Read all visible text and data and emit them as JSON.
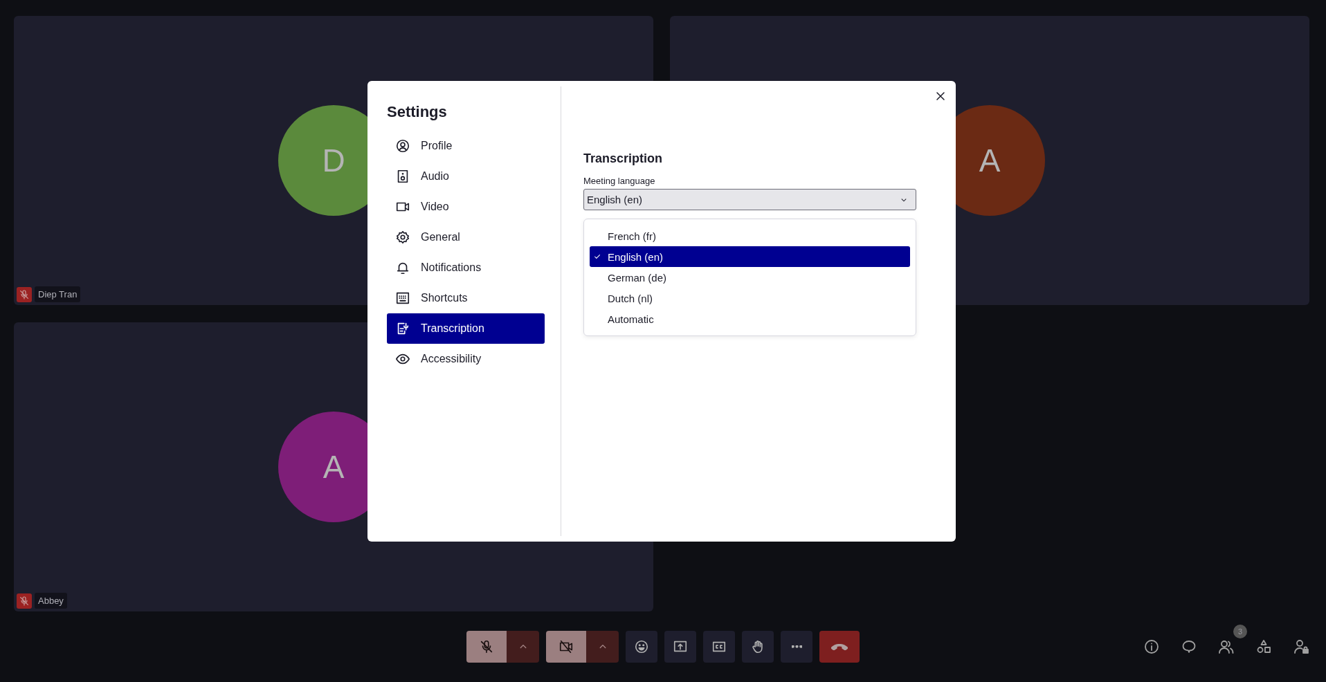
{
  "tiles": [
    {
      "initial": "D",
      "color": "#5b8a3c",
      "name": "Diep Tran",
      "muted": true
    },
    {
      "initial": "A",
      "color": "#6b2a14"
    },
    {
      "initial": "A",
      "color": "#7e1e78",
      "name": "Abbey",
      "muted": true
    }
  ],
  "settings": {
    "title": "Settings",
    "nav": [
      {
        "label": "Profile",
        "kind": "profile",
        "selected": false
      },
      {
        "label": "Audio",
        "kind": "audio",
        "selected": false
      },
      {
        "label": "Video",
        "kind": "video",
        "selected": false
      },
      {
        "label": "General",
        "kind": "general",
        "selected": false
      },
      {
        "label": "Notifications",
        "kind": "notifications",
        "selected": false
      },
      {
        "label": "Shortcuts",
        "kind": "shortcuts",
        "selected": false
      },
      {
        "label": "Transcription",
        "kind": "transcription",
        "selected": true
      },
      {
        "label": "Accessibility",
        "kind": "accessibility",
        "selected": false
      }
    ],
    "section_title": "Transcription",
    "field_label": "Meeting language",
    "value": "English (en)",
    "options": [
      {
        "label": "French (fr)",
        "selected": false
      },
      {
        "label": "English (en)",
        "selected": true
      },
      {
        "label": "German (de)",
        "selected": false
      },
      {
        "label": "Dutch (nl)",
        "selected": false
      },
      {
        "label": "Automatic",
        "selected": false
      }
    ]
  },
  "toolbar": [
    {
      "kind": "mic",
      "on": false
    },
    {
      "kind": "camera",
      "on": false
    },
    {
      "kind": "reactions"
    },
    {
      "kind": "share"
    },
    {
      "kind": "captions"
    },
    {
      "kind": "hand"
    },
    {
      "kind": "more"
    },
    {
      "kind": "leave"
    }
  ],
  "side_actions": [
    {
      "kind": "info"
    },
    {
      "kind": "chat"
    },
    {
      "kind": "participants",
      "badge": "3"
    },
    {
      "kind": "apps"
    },
    {
      "kind": "host"
    }
  ]
}
